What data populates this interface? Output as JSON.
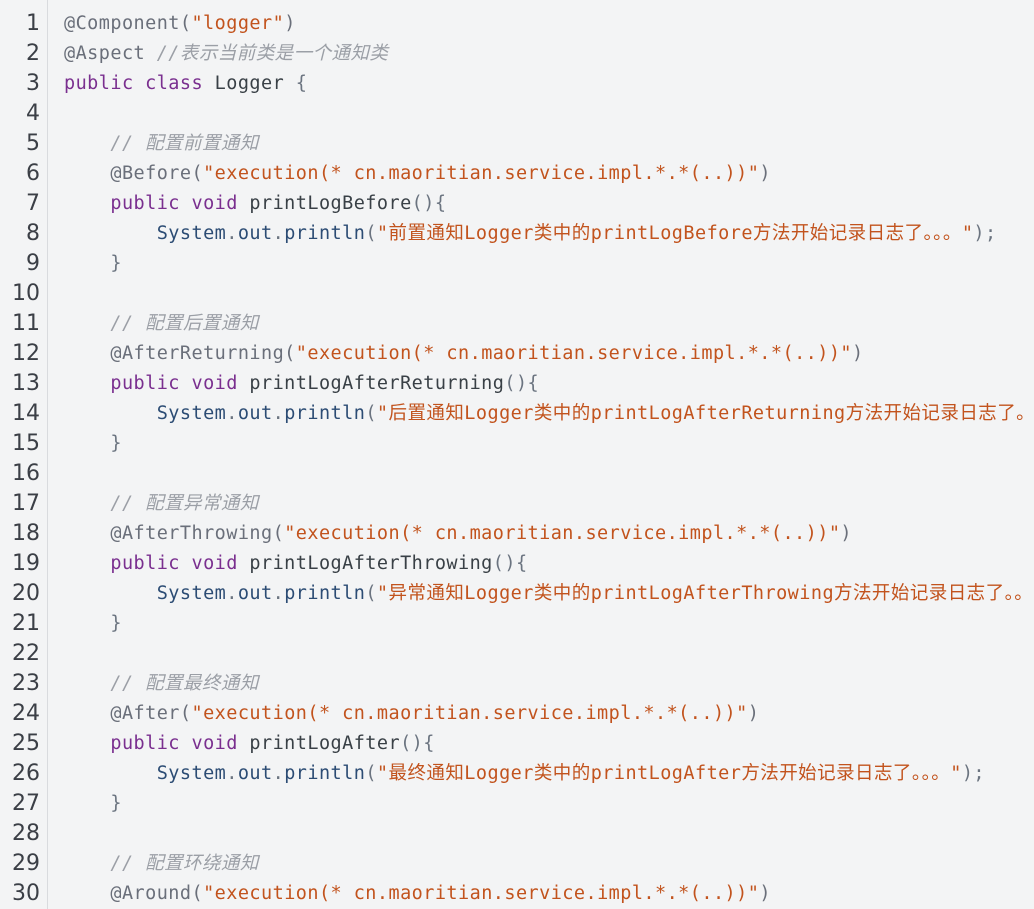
{
  "theme": {
    "background": "#f3f4f5",
    "gutter_border": "#d9dbde",
    "line_number": "#3b3f46",
    "annotation": "#6a6f7a",
    "keyword": "#7a2f8f",
    "string": "#c2531d",
    "comment": "#9b9fa6",
    "plain": "#394046",
    "member": "#2c4c74",
    "punct": "#6b7480"
  },
  "editor": {
    "lines": [
      {
        "number": "1",
        "tokens": [
          {
            "type": "annotation",
            "text": "@Component("
          },
          {
            "type": "string",
            "text": "\"logger\""
          },
          {
            "type": "annotation",
            "text": ")"
          }
        ]
      },
      {
        "number": "2",
        "tokens": [
          {
            "type": "annotation",
            "text": "@Aspect "
          },
          {
            "type": "comment",
            "text": "//表示当前类是一个通知类"
          }
        ]
      },
      {
        "number": "3",
        "tokens": [
          {
            "type": "keyword",
            "text": "public class "
          },
          {
            "type": "plain",
            "text": "Logger "
          },
          {
            "type": "punct",
            "text": "{"
          }
        ]
      },
      {
        "number": "4",
        "tokens": []
      },
      {
        "number": "5",
        "tokens": [
          {
            "type": "plain",
            "text": "    "
          },
          {
            "type": "comment",
            "text": "// 配置前置通知"
          }
        ]
      },
      {
        "number": "6",
        "tokens": [
          {
            "type": "plain",
            "text": "    "
          },
          {
            "type": "annotation",
            "text": "@Before("
          },
          {
            "type": "string",
            "text": "\"execution(* cn.maoritian.service.impl.*.*(..))\""
          },
          {
            "type": "annotation",
            "text": ")"
          }
        ]
      },
      {
        "number": "7",
        "tokens": [
          {
            "type": "plain",
            "text": "    "
          },
          {
            "type": "keyword",
            "text": "public void "
          },
          {
            "type": "method",
            "text": "printLogBefore"
          },
          {
            "type": "punct",
            "text": "(){"
          }
        ]
      },
      {
        "number": "8",
        "tokens": [
          {
            "type": "plain",
            "text": "        "
          },
          {
            "type": "member",
            "text": "System"
          },
          {
            "type": "punct",
            "text": "."
          },
          {
            "type": "member",
            "text": "out"
          },
          {
            "type": "punct",
            "text": "."
          },
          {
            "type": "member",
            "text": "println"
          },
          {
            "type": "punct",
            "text": "("
          },
          {
            "type": "string",
            "text": "\"前置通知Logger类中的printLogBefore方法开始记录日志了。。。\""
          },
          {
            "type": "punct",
            "text": ");"
          }
        ]
      },
      {
        "number": "9",
        "tokens": [
          {
            "type": "plain",
            "text": "    "
          },
          {
            "type": "punct",
            "text": "}"
          }
        ]
      },
      {
        "number": "10",
        "tokens": []
      },
      {
        "number": "11",
        "tokens": [
          {
            "type": "plain",
            "text": "    "
          },
          {
            "type": "comment",
            "text": "// 配置后置通知"
          }
        ]
      },
      {
        "number": "12",
        "tokens": [
          {
            "type": "plain",
            "text": "    "
          },
          {
            "type": "annotation",
            "text": "@AfterReturning("
          },
          {
            "type": "string",
            "text": "\"execution(* cn.maoritian.service.impl.*.*(..))\""
          },
          {
            "type": "annotation",
            "text": ")"
          }
        ]
      },
      {
        "number": "13",
        "tokens": [
          {
            "type": "plain",
            "text": "    "
          },
          {
            "type": "keyword",
            "text": "public void "
          },
          {
            "type": "method",
            "text": "printLogAfterReturning"
          },
          {
            "type": "punct",
            "text": "(){"
          }
        ]
      },
      {
        "number": "14",
        "tokens": [
          {
            "type": "plain",
            "text": "        "
          },
          {
            "type": "member",
            "text": "System"
          },
          {
            "type": "punct",
            "text": "."
          },
          {
            "type": "member",
            "text": "out"
          },
          {
            "type": "punct",
            "text": "."
          },
          {
            "type": "member",
            "text": "println"
          },
          {
            "type": "punct",
            "text": "("
          },
          {
            "type": "string",
            "text": "\"后置通知Logger类中的printLogAfterReturning方法开始记录日志了。"
          }
        ]
      },
      {
        "number": "15",
        "tokens": [
          {
            "type": "plain",
            "text": "    "
          },
          {
            "type": "punct",
            "text": "}"
          }
        ]
      },
      {
        "number": "16",
        "tokens": []
      },
      {
        "number": "17",
        "tokens": [
          {
            "type": "plain",
            "text": "    "
          },
          {
            "type": "comment",
            "text": "// 配置异常通知"
          }
        ]
      },
      {
        "number": "18",
        "tokens": [
          {
            "type": "plain",
            "text": "    "
          },
          {
            "type": "annotation",
            "text": "@AfterThrowing("
          },
          {
            "type": "string",
            "text": "\"execution(* cn.maoritian.service.impl.*.*(..))\""
          },
          {
            "type": "annotation",
            "text": ")"
          }
        ]
      },
      {
        "number": "19",
        "tokens": [
          {
            "type": "plain",
            "text": "    "
          },
          {
            "type": "keyword",
            "text": "public void "
          },
          {
            "type": "method",
            "text": "printLogAfterThrowing"
          },
          {
            "type": "punct",
            "text": "(){"
          }
        ]
      },
      {
        "number": "20",
        "tokens": [
          {
            "type": "plain",
            "text": "        "
          },
          {
            "type": "member",
            "text": "System"
          },
          {
            "type": "punct",
            "text": "."
          },
          {
            "type": "member",
            "text": "out"
          },
          {
            "type": "punct",
            "text": "."
          },
          {
            "type": "member",
            "text": "println"
          },
          {
            "type": "punct",
            "text": "("
          },
          {
            "type": "string",
            "text": "\"异常通知Logger类中的printLogAfterThrowing方法开始记录日志了。。"
          }
        ]
      },
      {
        "number": "21",
        "tokens": [
          {
            "type": "plain",
            "text": "    "
          },
          {
            "type": "punct",
            "text": "}"
          }
        ]
      },
      {
        "number": "22",
        "tokens": []
      },
      {
        "number": "23",
        "tokens": [
          {
            "type": "plain",
            "text": "    "
          },
          {
            "type": "comment",
            "text": "// 配置最终通知"
          }
        ]
      },
      {
        "number": "24",
        "tokens": [
          {
            "type": "plain",
            "text": "    "
          },
          {
            "type": "annotation",
            "text": "@After("
          },
          {
            "type": "string",
            "text": "\"execution(* cn.maoritian.service.impl.*.*(..))\""
          },
          {
            "type": "annotation",
            "text": ")"
          }
        ]
      },
      {
        "number": "25",
        "tokens": [
          {
            "type": "plain",
            "text": "    "
          },
          {
            "type": "keyword",
            "text": "public void "
          },
          {
            "type": "method",
            "text": "printLogAfter"
          },
          {
            "type": "punct",
            "text": "(){"
          }
        ]
      },
      {
        "number": "26",
        "tokens": [
          {
            "type": "plain",
            "text": "        "
          },
          {
            "type": "member",
            "text": "System"
          },
          {
            "type": "punct",
            "text": "."
          },
          {
            "type": "member",
            "text": "out"
          },
          {
            "type": "punct",
            "text": "."
          },
          {
            "type": "member",
            "text": "println"
          },
          {
            "type": "punct",
            "text": "("
          },
          {
            "type": "string",
            "text": "\"最终通知Logger类中的printLogAfter方法开始记录日志了。。。\""
          },
          {
            "type": "punct",
            "text": ");"
          }
        ]
      },
      {
        "number": "27",
        "tokens": [
          {
            "type": "plain",
            "text": "    "
          },
          {
            "type": "punct",
            "text": "}"
          }
        ]
      },
      {
        "number": "28",
        "tokens": []
      },
      {
        "number": "29",
        "tokens": [
          {
            "type": "plain",
            "text": "    "
          },
          {
            "type": "comment",
            "text": "// 配置环绕通知"
          }
        ]
      },
      {
        "number": "30",
        "tokens": [
          {
            "type": "plain",
            "text": "    "
          },
          {
            "type": "annotation",
            "text": "@Around("
          },
          {
            "type": "string",
            "text": "\"execution(* cn.maoritian.service.impl.*.*(..))\""
          },
          {
            "type": "annotation",
            "text": ")"
          }
        ]
      }
    ]
  }
}
